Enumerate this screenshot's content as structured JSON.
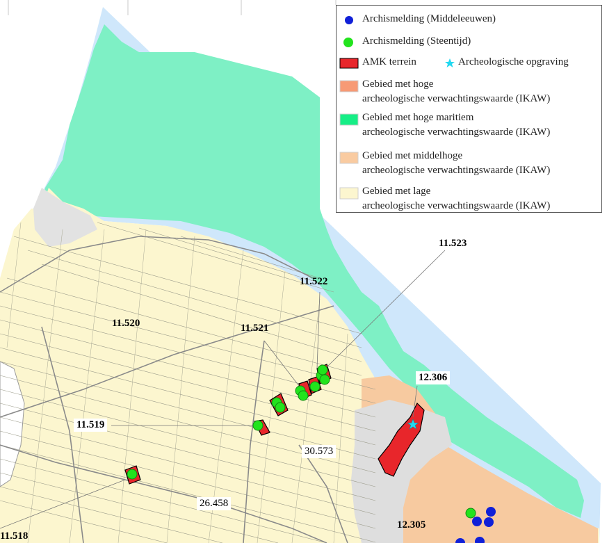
{
  "map": {
    "colors": {
      "sea_buffer": "#cfe7fb",
      "maritime_high": "#7ef0c5",
      "low": "#fcf6cf",
      "middle_high": "#f7caa0",
      "urban": "#e0e0e0",
      "amk": "#e8262b",
      "steentijd": "#22e31d",
      "middeleeuwen": "#1020d8",
      "opgraving": "#23d8f0"
    },
    "labels": {
      "l11518": "11.518",
      "l11519": "11.519",
      "l11520": "11.520",
      "l11521": "11.521",
      "l11522": "11.522",
      "l11523": "11.523",
      "l12305": "12.305",
      "l12306": "12.306",
      "l26458": "26.458",
      "l30573": "30.573"
    }
  },
  "legend": {
    "middeleeuwen": "Archismelding (Middeleeuwen)",
    "steentijd": "Archismelding (Steentijd)",
    "amk": "AMK terrein",
    "opgraving": "Archeologische opgraving",
    "hoge_1": "Gebied met hoge",
    "hoge_2": "archeologische verwachtingswaarde (IKAW)",
    "maritiem_1": "Gebied met hoge maritiem",
    "maritiem_2": "archeologische verwachtingswaarde (IKAW)",
    "middelhoge_1": "Gebied met middelhoge",
    "middelhoge_2": "archeologische verwachtingswaarde (IKAW)",
    "lage_1": "Gebied met lage",
    "lage_2": "archeologische verwachtingswaarde (IKAW)"
  }
}
